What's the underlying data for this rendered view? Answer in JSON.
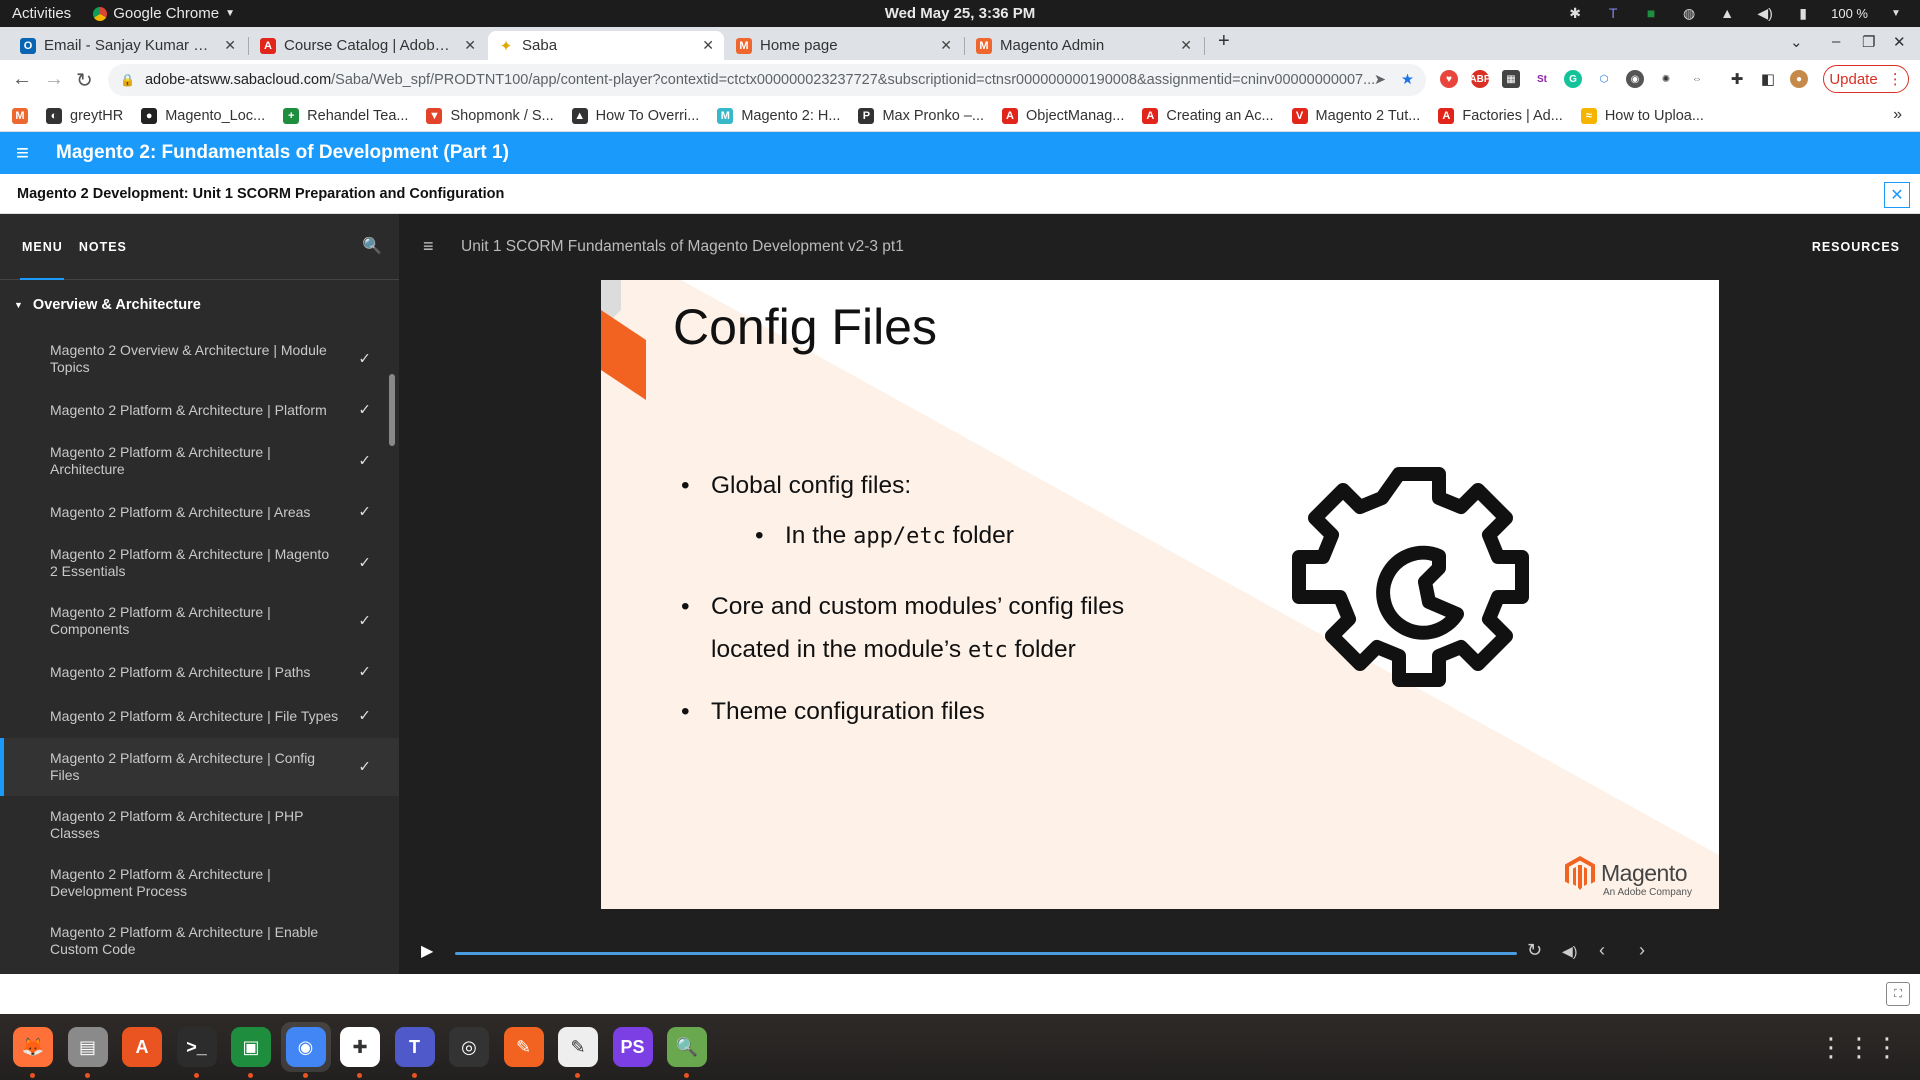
{
  "os_bar": {
    "activities": "Activities",
    "app_name": "Google Chrome",
    "clock": "Wed May 25,  3:36 PM",
    "battery": "100 %"
  },
  "tabs": [
    {
      "title": "Email - Sanjay Kumar Das",
      "icon": "outlook-icon",
      "color": "#0a64b4",
      "glyph": "O"
    },
    {
      "title": "Course Catalog | Adobe D",
      "icon": "adobe-icon",
      "color": "#e1251b",
      "glyph": "A"
    },
    {
      "title": "Saba",
      "icon": "saba-icon",
      "color": "#f4b400",
      "glyph": "✦"
    },
    {
      "title": "Home page",
      "icon": "magento-icon",
      "color": "#ee672f",
      "glyph": "M"
    },
    {
      "title": "Magento Admin",
      "icon": "magento-icon",
      "color": "#ee672f",
      "glyph": "M"
    }
  ],
  "toolbar": {
    "url_host": "adobe-atsww.sabacloud.com",
    "url_rest": "/Saba/Web_spf/PRODTNT100/app/content-player?contextid=ctctx000000023237727&subscriptionid=ctnsr000000000190008&assignmentid=cninv00000000007...",
    "update_label": "Update"
  },
  "bookmarks": [
    {
      "label": "greytHR",
      "color": "#333",
      "glyph": "◐"
    },
    {
      "label": "Magento_Loc...",
      "color": "#222",
      "glyph": "●"
    },
    {
      "label": "Rehandel Tea...",
      "color": "#1e8e3e",
      "glyph": "+"
    },
    {
      "label": "Shopmonk / S...",
      "color": "#e24329",
      "glyph": "▼"
    },
    {
      "label": "How To Overri...",
      "color": "#333",
      "glyph": "▲"
    },
    {
      "label": "Magento 2: H...",
      "color": "#36b8c8",
      "glyph": "M"
    },
    {
      "label": "Max Pronko –...",
      "color": "#333",
      "glyph": "P"
    },
    {
      "label": "ObjectManag...",
      "color": "#e1251b",
      "glyph": "A"
    },
    {
      "label": "Creating an Ac...",
      "color": "#e1251b",
      "glyph": "A"
    },
    {
      "label": "Magento 2 Tut...",
      "color": "#e1251b",
      "glyph": "V"
    },
    {
      "label": "Factories | Ad...",
      "color": "#e1251b",
      "glyph": "A"
    },
    {
      "label": "How to Uploa...",
      "color": "#f4b400",
      "glyph": "≈"
    }
  ],
  "app": {
    "course_title": "Magento 2: Fundamentals of Development (Part 1)",
    "unit_title": "Magento 2 Development: Unit 1 SCORM Preparation and Configuration",
    "accent": "#1a9bfc"
  },
  "sidebar": {
    "tab_menu": "MENU",
    "tab_notes": "NOTES",
    "section": "Overview & Architecture",
    "lessons": [
      {
        "label": "Magento 2 Overview & Architecture | Module Topics",
        "done": true
      },
      {
        "label": "Magento 2 Platform & Architecture | Platform",
        "done": true
      },
      {
        "label": "Magento 2 Platform & Architecture | Architecture",
        "done": true
      },
      {
        "label": "Magento 2 Platform & Architecture | Areas",
        "done": true
      },
      {
        "label": "Magento 2 Platform & Architecture | Magento 2 Essentials",
        "done": true
      },
      {
        "label": "Magento 2 Platform & Architecture | Components",
        "done": true
      },
      {
        "label": "Magento 2 Platform & Architecture | Paths",
        "done": true
      },
      {
        "label": "Magento 2 Platform & Architecture | File Types",
        "done": true
      },
      {
        "label": "Magento 2 Platform & Architecture | Config Files",
        "done": true,
        "active": true
      },
      {
        "label": "Magento 2 Platform & Architecture | PHP Classes",
        "done": false
      },
      {
        "label": "Magento 2 Platform & Architecture | Development Process",
        "done": false
      },
      {
        "label": "Magento 2 Platform & Architecture | Enable Custom Code",
        "done": false
      }
    ]
  },
  "player": {
    "title": "Unit 1 SCORM Fundamentals of Magento Development v2-3 pt1",
    "resources": "RESOURCES"
  },
  "slide": {
    "title": "Config Files",
    "b1": "Global config files:",
    "b1_sub_pre": "In the ",
    "b1_sub_code": "app/etc",
    "b1_sub_post": " folder",
    "b2_line1": "Core and custom modules’ config files",
    "b2_line2_pre": "located in the module’s ",
    "b2_line2_code": "etc",
    "b2_line2_post": "  folder",
    "b3": "Theme configuration files",
    "logo_word": "Magento",
    "logo_tag": "An Adobe Company",
    "brand_orange": "#f26322"
  },
  "dock": [
    {
      "name": "firefox-icon",
      "color": "#ff7139",
      "glyph": "🦊",
      "running": true
    },
    {
      "name": "files-icon",
      "color": "#8a8a8a",
      "glyph": "▤",
      "running": true
    },
    {
      "name": "software-center-icon",
      "color": "#e95420",
      "glyph": "A",
      "running": false
    },
    {
      "name": "terminal-icon",
      "color": "#2c2c2c",
      "glyph": ">_",
      "running": true
    },
    {
      "name": "google-chat-icon",
      "color": "#1e8e3e",
      "glyph": "▣",
      "running": true
    },
    {
      "name": "chrome-icon",
      "color": "#4285f4",
      "glyph": "◉",
      "running": true,
      "focused": true
    },
    {
      "name": "slack-icon",
      "color": "#fff",
      "glyph": "✚",
      "running": true
    },
    {
      "name": "teams-icon",
      "color": "#5059c9",
      "glyph": "T",
      "running": true
    },
    {
      "name": "camera-icon",
      "color": "#333",
      "glyph": "◎",
      "running": false
    },
    {
      "name": "draw-icon",
      "color": "#f26322",
      "glyph": "✎",
      "running": false
    },
    {
      "name": "text-editor-icon",
      "color": "#eee",
      "glyph": "✎",
      "running": true
    },
    {
      "name": "phpstorm-icon",
      "color": "#7b3fe4",
      "glyph": "PS",
      "running": false
    },
    {
      "name": "image-viewer-icon",
      "color": "#6aa84f",
      "glyph": "🔍",
      "running": true
    }
  ]
}
